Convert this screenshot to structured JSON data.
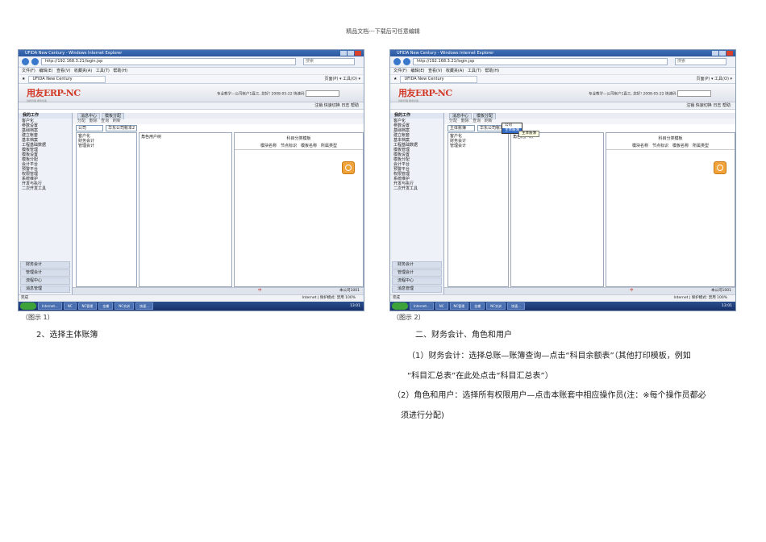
{
  "header_note": "精品文档---下载后可任意编辑",
  "window": {
    "title": "UFIDA New Century - Windows Internet Explorer",
    "url": "http://192.168.3.21/login.jsp",
    "search_placeholder": "搜索",
    "menu": "文件(F)  编辑(E)  查看(V)  收藏夹(A)  工具(T)  帮助(H)",
    "fav_tab": "UFIDA New Century",
    "ie_commands": "页面(P) ▾  工具(O) ▾"
  },
  "app": {
    "logo": "用友ERP-NC",
    "logo_sub": "创新管理  服务创造",
    "banner_info": "专业教学—公司帐户1直三, 您好! 2008-05-22  快速码",
    "top_links": "注销  快速切换  日志  帮助",
    "left_title": "我的工作",
    "left_tree": [
      "客户化",
      "参数设置",
      "基础档案",
      "建立帐套",
      "基本档案",
      "工程基础数据",
      "模板管理",
      "模板设置",
      "模板分配",
      "会计平台",
      "预警平台",
      "权限管理",
      "系统维护",
      "开发与执行",
      "二次开发工具"
    ],
    "left_bottom": [
      "财务会计",
      "管理会计",
      "流程中心",
      "消息管理"
    ],
    "tabs": [
      "消息中心",
      "模板分配"
    ],
    "toolbar": "分配  删除  查询  刷新",
    "select1": "公司",
    "select2": "华东公司帐本2",
    "tree2": [
      "客户化",
      "财务会计",
      "管理会计"
    ],
    "pane2_label": "角色用户树",
    "pane3_caption": "科目分类模板",
    "pane3_headers": [
      "模块名称",
      "节点标识",
      "模板名称",
      "所属类型"
    ],
    "status_center": "中",
    "status_right": "本公司1001",
    "ie_status_left": "完成",
    "ie_status_right": "Internet | 保护模式: 禁用    100%",
    "taskbar_items": [
      "Internet...",
      "NC",
      "NC管理",
      "金蝶",
      "NC实训",
      "快速..."
    ],
    "clock": "13:01"
  },
  "shot2_extra": {
    "select1": "主体账簿",
    "popup": [
      "公司",
      "主体账簿"
    ],
    "tooltip": "主体账簿"
  },
  "captions": {
    "fig1": "（图示 1）",
    "fig2": "（图示 2）"
  },
  "body_text": {
    "step2": "2、选择主体账簿",
    "section": "二、财务会计、角色和用户",
    "p1_line1": "（1）财务会计：选择总账—账簿查询—点击“科目余额表”（其他打印模板，例如",
    "p1_line2": "“科目汇总表”在此处点击“科目汇总表”）",
    "p2_line1": "（2）角色和用户：选择所有权限用户—点击本账套中相应操作员(注：※每个操作员都必",
    "p2_line2": "须进行分配)"
  }
}
